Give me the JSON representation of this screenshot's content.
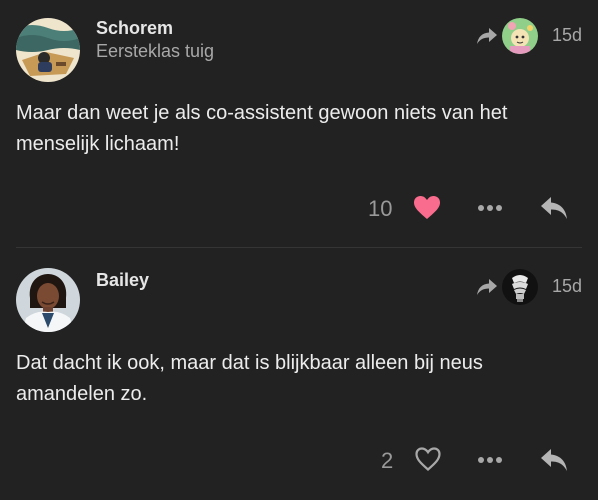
{
  "posts": [
    {
      "username": "Schorem",
      "user_title": "Eersteklas tuig",
      "date": "15d",
      "body": "Maar dan weet je als co-assistent gewoon niets van het menselijk lichaam!",
      "likes": "10",
      "liked": true
    },
    {
      "username": "Bailey",
      "user_title": "",
      "date": "15d",
      "body": "Dat dacht ik ook, maar dat is blijkbaar alleen bij neus amandelen zo.",
      "likes": "2",
      "liked": false
    }
  ],
  "colors": {
    "background": "#222222",
    "heart_liked": "#fa6c8d",
    "icon": "#a8a8a8",
    "text": "#ececec"
  },
  "icons": {
    "reply_to": "reply-to-icon",
    "like": "heart-icon",
    "more": "more-options-icon",
    "share": "reply-icon"
  }
}
